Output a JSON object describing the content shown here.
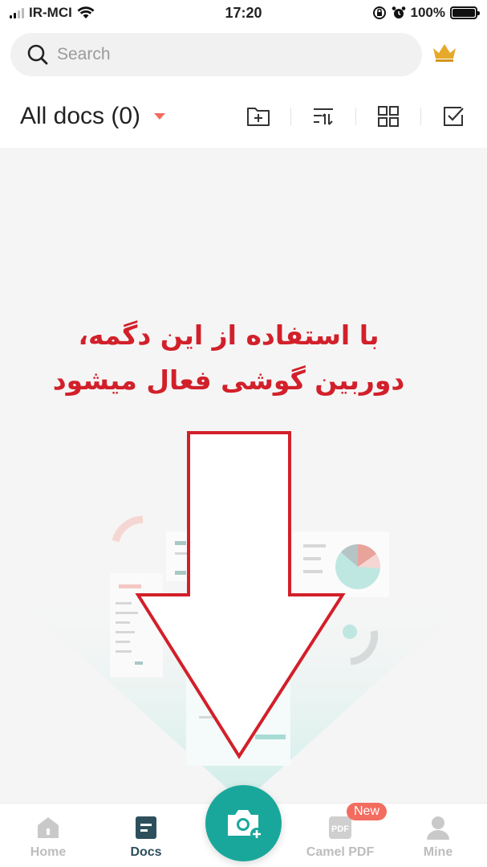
{
  "status_bar": {
    "carrier": "IR-MCI",
    "time": "17:20",
    "battery": "100%"
  },
  "search": {
    "placeholder": "Search"
  },
  "toolbar": {
    "title": "All docs (0)",
    "icons": [
      "new-folder-icon",
      "sort-icon",
      "grid-view-icon",
      "select-icon"
    ]
  },
  "annotation": {
    "line1": "با  استفاده از این دگمه،",
    "line2": "دوربین گوشی فعال میشود"
  },
  "bottom_nav": {
    "items": [
      {
        "label": "Home",
        "active": false
      },
      {
        "label": "Docs",
        "active": true
      },
      {
        "label": "Camel PDF",
        "active": false,
        "badge": "New",
        "icon_text": "PDF"
      },
      {
        "label": "Mine",
        "active": false
      }
    ]
  },
  "colors": {
    "accent": "#1aa79b",
    "annotation": "#d2202a",
    "badge": "#f26c5f",
    "dropdown": "#f26c5f",
    "crown": "#e6a92a"
  }
}
